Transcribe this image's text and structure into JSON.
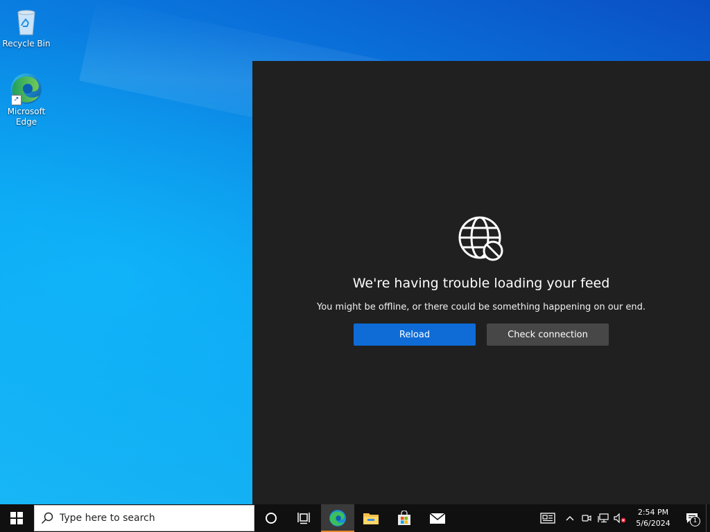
{
  "desktop": {
    "icons": [
      {
        "label": "Recycle Bin"
      },
      {
        "label": "Microsoft Edge"
      }
    ]
  },
  "feed": {
    "title": "We're having trouble loading your feed",
    "message": "You might be offline, or there could be something happening on our end.",
    "reload_label": "Reload",
    "check_label": "Check connection"
  },
  "taskbar": {
    "search_placeholder": "Type here to search",
    "apps": [
      "start-icon",
      "cortana-icon",
      "task-view-icon",
      "edge-icon",
      "file-explorer-icon",
      "store-icon",
      "mail-icon"
    ],
    "active_app": "edge-icon"
  },
  "tray": {
    "time": "2:54 PM",
    "date": "5/6/2024",
    "notification_count": "1",
    "icons": [
      "news-icon",
      "chevron-up-icon",
      "meet-now-icon",
      "network-icon",
      "volume-muted-icon"
    ]
  },
  "colors": {
    "accent": "#0f6cd6",
    "panel_bg": "#202020",
    "secondary_button": "#474747",
    "taskbar_bg": "#101010"
  }
}
